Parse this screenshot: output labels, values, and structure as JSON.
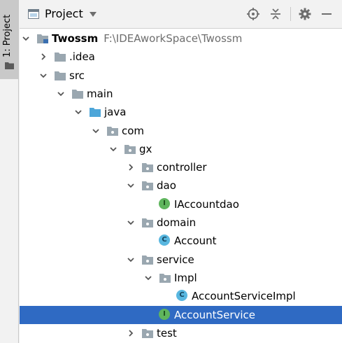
{
  "toolStrip": {
    "tabLabel": "1: Project"
  },
  "header": {
    "title": "Project"
  },
  "tree": [
    {
      "label": "Twossm",
      "path": "F:\\IDEAworkSpace\\Twossm",
      "level": 0,
      "expanded": true,
      "icon": "module-folder-icon",
      "bold": true
    },
    {
      "label": ".idea",
      "level": 1,
      "expanded": false,
      "icon": "folder-icon"
    },
    {
      "label": "src",
      "level": 1,
      "expanded": true,
      "icon": "folder-icon"
    },
    {
      "label": "main",
      "level": 2,
      "expanded": true,
      "icon": "folder-icon"
    },
    {
      "label": "java",
      "level": 3,
      "expanded": true,
      "icon": "source-folder-icon"
    },
    {
      "label": "com",
      "level": 4,
      "expanded": true,
      "icon": "package-icon"
    },
    {
      "label": "gx",
      "level": 5,
      "expanded": true,
      "icon": "package-icon"
    },
    {
      "label": "controller",
      "level": 6,
      "expanded": false,
      "icon": "package-icon"
    },
    {
      "label": "dao",
      "level": 6,
      "expanded": true,
      "icon": "package-icon"
    },
    {
      "label": "IAccountdao",
      "level": 7,
      "icon": "interface-icon",
      "badge": "I"
    },
    {
      "label": "domain",
      "level": 6,
      "expanded": true,
      "icon": "package-icon"
    },
    {
      "label": "Account",
      "level": 7,
      "icon": "class-icon",
      "badge": "C"
    },
    {
      "label": "service",
      "level": 6,
      "expanded": true,
      "icon": "package-icon"
    },
    {
      "label": "Impl",
      "level": 7,
      "expanded": true,
      "icon": "package-icon"
    },
    {
      "label": "AccountServiceImpl",
      "level": 8,
      "icon": "class-icon",
      "badge": "C"
    },
    {
      "label": "AccountService",
      "level": 7,
      "icon": "interface-icon",
      "badge": "I",
      "selected": true
    },
    {
      "label": "test",
      "level": 6,
      "expanded": false,
      "icon": "package-icon"
    }
  ],
  "colors": {
    "selection": "#2f6ac3",
    "folder": "#9aa7b0",
    "sourceFolder": "#4da6d9",
    "interface": "#5fb55d",
    "class": "#59b7e0"
  }
}
